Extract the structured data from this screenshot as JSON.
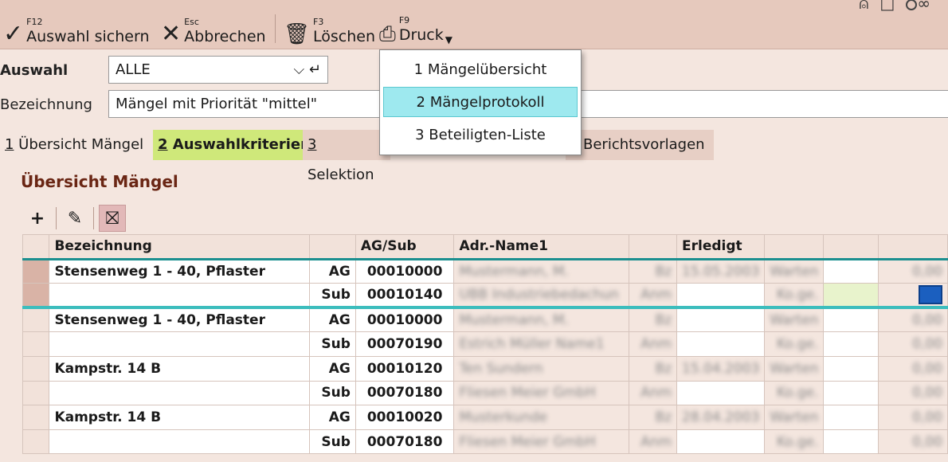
{
  "toolbar": {
    "buttons": [
      {
        "key": "F12",
        "label": "Auswahl sichern",
        "icon": "check-icon"
      },
      {
        "key": "Esc",
        "label": "Abbrechen",
        "icon": "close-icon"
      },
      {
        "key": "F3",
        "label": "Löschen",
        "icon": "trash-icon"
      },
      {
        "key": "F9",
        "label": "Druck",
        "icon": "printer-icon"
      }
    ]
  },
  "form": {
    "auswahl_label": "Auswahl",
    "auswahl_value": "ALLE",
    "bezeichnung_label": "Bezeichnung",
    "bezeichnung_value": "Mängel mit Priorität \"mittel\""
  },
  "tabs": [
    {
      "num": "1",
      "label": " Übersicht Mängel"
    },
    {
      "num": "2",
      "label": " Auswahlkriterien"
    },
    {
      "num": "3",
      "label": " Selektion"
    },
    {
      "label": "Berichtsvorlagen"
    }
  ],
  "section_title": "Übersicht Mängel",
  "print_menu": {
    "items": [
      "1 Mängelübersicht",
      "2 Mängelprotokoll",
      "3 Beteiligten-Liste"
    ],
    "highlighted_index": 1
  },
  "grid": {
    "columns": [
      "Bezeichnung",
      "",
      "AG/Sub",
      "Adr.-Name1",
      "",
      "Erledigt",
      "",
      "",
      ""
    ],
    "rows": [
      {
        "bezeichnung": "Stensenweg 1 - 40, Pflaster",
        "type": "AG",
        "nr": "00010000",
        "name": "Mustermann, M.",
        "kz": "Bz",
        "date": "15.05.2003",
        "status": "Warten",
        "val": "0,00"
      },
      {
        "bezeichnung": "",
        "type": "Sub",
        "nr": "00010140",
        "name": "UBB Industriebedachun",
        "kz": "Anm",
        "date": "",
        "status": "Ko.ge.",
        "val": ""
      },
      {
        "bezeichnung": "Stensenweg 1 - 40, Pflaster",
        "type": "AG",
        "nr": "00010000",
        "name": "Mustermann, M.",
        "kz": "Bz",
        "date": "",
        "status": "Warten",
        "val": "0,00"
      },
      {
        "bezeichnung": "",
        "type": "Sub",
        "nr": "00070190",
        "name": "Estrich Müller Name1",
        "kz": "Anm",
        "date": "",
        "status": "Ko.ge.",
        "val": "0,00"
      },
      {
        "bezeichnung": "Kampstr. 14 B",
        "type": "AG",
        "nr": "00010120",
        "name": "Ten Sundern",
        "kz": "Bz",
        "date": "15.04.2003",
        "status": "Warten",
        "val": "0,00"
      },
      {
        "bezeichnung": "",
        "type": "Sub",
        "nr": "00070180",
        "name": "Fliesen Meier GmbH",
        "kz": "Anm",
        "date": "",
        "status": "Ko.ge.",
        "val": "0,00"
      },
      {
        "bezeichnung": "Kampstr. 14 B",
        "type": "AG",
        "nr": "00010020",
        "name": "Musterkunde",
        "kz": "Bz",
        "date": "28.04.2003",
        "status": "Warten",
        "val": "0,00"
      },
      {
        "bezeichnung": "",
        "type": "Sub",
        "nr": "00070180",
        "name": "Fliesen Meier GmbH",
        "kz": "Anm",
        "date": "",
        "status": "Ko.ge.",
        "val": "0,00"
      }
    ]
  }
}
